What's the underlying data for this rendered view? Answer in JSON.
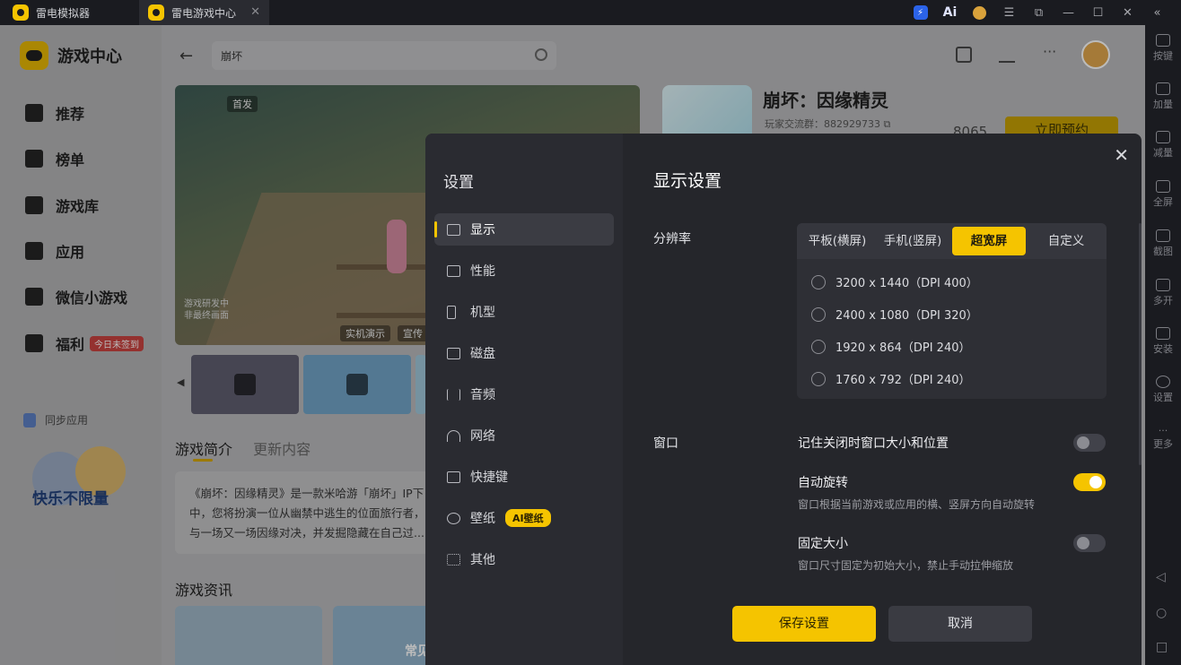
{
  "window": {
    "tabs": [
      {
        "label": "雷电模拟器"
      },
      {
        "label": "雷电游戏中心"
      }
    ],
    "close_glyph": "✕"
  },
  "right_toolbar": [
    {
      "label": "按键",
      "icon": "keyboard-icon"
    },
    {
      "label": "加量",
      "icon": "volume-up-icon"
    },
    {
      "label": "减量",
      "icon": "volume-down-icon"
    },
    {
      "label": "全屏",
      "icon": "fullscreen-icon"
    },
    {
      "label": "截图",
      "icon": "scissors-icon"
    },
    {
      "label": "多开",
      "icon": "multi-instance-icon"
    },
    {
      "label": "安装",
      "icon": "install-icon"
    },
    {
      "label": "设置",
      "icon": "gear-icon"
    },
    {
      "label": "更多",
      "icon": "more-icon"
    }
  ],
  "sidebar": {
    "app_title": "游戏中心",
    "items": [
      {
        "label": "推荐"
      },
      {
        "label": "榜单"
      },
      {
        "label": "游戏库"
      },
      {
        "label": "应用"
      },
      {
        "label": "微信小游戏"
      },
      {
        "label": "福利",
        "badge": "今日未签到"
      }
    ],
    "sync_label": "同步应用",
    "promo_text": "快乐不限量"
  },
  "header": {
    "search_value": "崩坏"
  },
  "game": {
    "title": "崩坏：因缘精灵",
    "group": "玩家交流群：882929733",
    "count": "8065",
    "reserve_label": "立即预约",
    "hero_tags": [
      "首发",
      "实机演示",
      "宣传"
    ],
    "hero_note_1": "游戏研发中",
    "hero_note_2": "非最终画面",
    "section_tabs": [
      "游戏简介",
      "更新内容"
    ],
    "intro_lines": [
      "《崩坏：因缘精灵》是一款米哈游「崩坏」IP下",
      "中，您将扮演一位从幽禁中逃生的位面旅行者，",
      "与一场又一场因缘对决，并发掘隐藏在自己过..."
    ],
    "news_title": "游戏资讯",
    "news_tag": "常见"
  },
  "settings": {
    "heading": "设置",
    "title": "显示设置",
    "nav": [
      {
        "label": "显示",
        "icon": "monitor-icon",
        "active": true
      },
      {
        "label": "性能",
        "icon": "performance-icon"
      },
      {
        "label": "机型",
        "icon": "phone-icon"
      },
      {
        "label": "磁盘",
        "icon": "disk-icon"
      },
      {
        "label": "音频",
        "icon": "audio-icon"
      },
      {
        "label": "网络",
        "icon": "wifi-icon"
      },
      {
        "label": "快捷键",
        "icon": "keyboard-icon"
      },
      {
        "label": "壁纸",
        "icon": "palette-icon",
        "badge": "AI壁纸"
      },
      {
        "label": "其他",
        "icon": "grid-icon"
      }
    ],
    "resolution_label": "分辨率",
    "resolution_tabs": [
      "平板(横屏)",
      "手机(竖屏)",
      "超宽屏",
      "自定义"
    ],
    "active_tab": "超宽屏",
    "resolutions": [
      "3200 x 1440（DPI 400）",
      "2400 x 1080（DPI 320）",
      "1920 x 864（DPI 240）",
      "1760 x 792（DPI 240）"
    ],
    "window_label": "窗口",
    "options": [
      {
        "title": "记住关闭时窗口大小和位置",
        "desc": "",
        "enabled": false
      },
      {
        "title": "自动旋转",
        "desc": "窗口根据当前游戏或应用的横、竖屏方向自动旋转",
        "enabled": true
      },
      {
        "title": "固定大小",
        "desc": "窗口尺寸固定为初始大小，禁止手动拉伸缩放",
        "enabled": false
      }
    ],
    "save_label": "保存设置",
    "cancel_label": "取消",
    "close_glyph": "✕"
  },
  "colors": {
    "accent": "#f5c400",
    "modal_bg": "#25262b",
    "badge_red": "#c9413e"
  }
}
